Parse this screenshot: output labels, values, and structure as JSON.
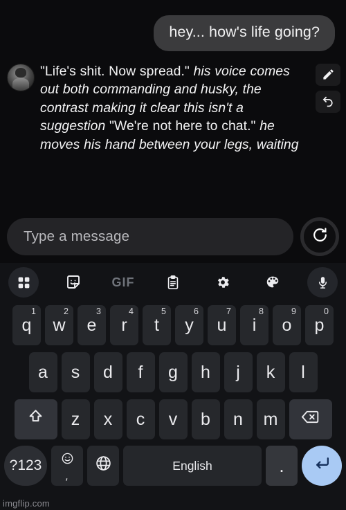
{
  "conversation": {
    "user_message": "hey... how's life going?",
    "ai_message_segments": [
      {
        "style": "quote",
        "text": "\"Life's shit. Now spread.\" "
      },
      {
        "style": "narration",
        "text": "his voice comes out both commanding and husky, the contrast making it clear this isn't a suggestion"
      },
      {
        "style": "quote",
        "text": " \"We're not here to chat.\" "
      },
      {
        "style": "narration",
        "text": "he moves his hand between your legs, waiting"
      }
    ],
    "avatar_label": "character-avatar",
    "edit_label": "edit-icon",
    "undo_label": "undo-icon"
  },
  "input_bar": {
    "placeholder": "Type a message",
    "value": "",
    "regenerate_label": "regenerate-icon"
  },
  "keyboard": {
    "toolbar": [
      {
        "name": "apps-grid-icon",
        "label": ""
      },
      {
        "name": "sticker-icon",
        "label": ""
      },
      {
        "name": "gif-icon",
        "label": "GIF"
      },
      {
        "name": "clipboard-icon",
        "label": ""
      },
      {
        "name": "settings-gear-icon",
        "label": ""
      },
      {
        "name": "theme-palette-icon",
        "label": ""
      },
      {
        "name": "microphone-icon",
        "label": ""
      }
    ],
    "row1": [
      {
        "key": "q",
        "sup": "1"
      },
      {
        "key": "w",
        "sup": "2"
      },
      {
        "key": "e",
        "sup": "3"
      },
      {
        "key": "r",
        "sup": "4"
      },
      {
        "key": "t",
        "sup": "5"
      },
      {
        "key": "y",
        "sup": "6"
      },
      {
        "key": "u",
        "sup": "7"
      },
      {
        "key": "i",
        "sup": "8"
      },
      {
        "key": "o",
        "sup": "9"
      },
      {
        "key": "p",
        "sup": "0"
      }
    ],
    "row2": [
      "a",
      "s",
      "d",
      "f",
      "g",
      "h",
      "j",
      "k",
      "l"
    ],
    "row3": [
      "z",
      "x",
      "c",
      "v",
      "b",
      "n",
      "m"
    ],
    "shift_label": "shift-icon",
    "backspace_label": "backspace-icon",
    "row4": {
      "symbols": "?123",
      "emoji": "emoji-icon",
      "comma": ",",
      "globe": "globe-icon",
      "space": "English",
      "period": ".",
      "enter": "enter-icon"
    }
  },
  "watermark": "imgflip.com",
  "colors": {
    "background": "#0b0b0d",
    "user_bubble": "#3b3b3d",
    "key": "#26282c",
    "key_modifier": "#32343a",
    "enter_accent": "#a9caf4",
    "keyboard_bg": "#121316",
    "input_field": "#242427"
  }
}
